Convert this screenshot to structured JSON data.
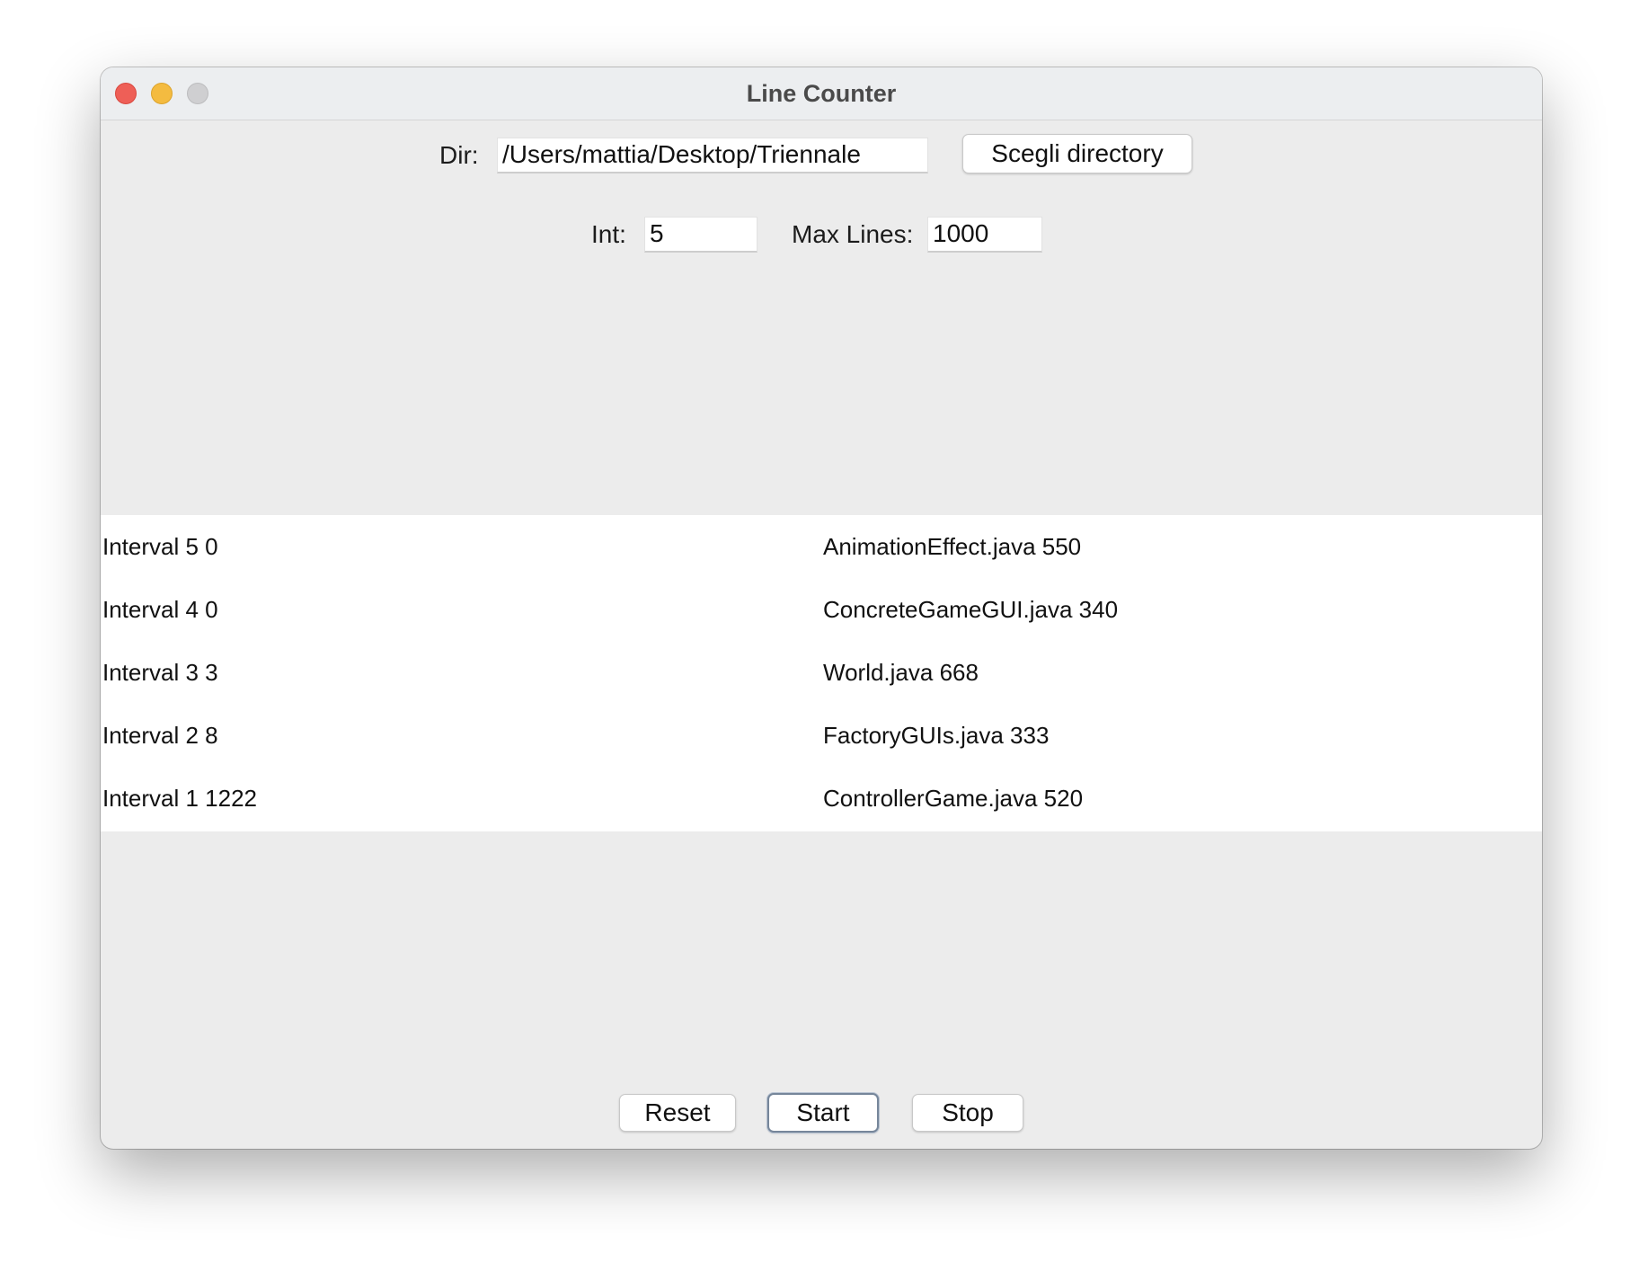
{
  "window": {
    "title": "Line Counter"
  },
  "controls": {
    "dir_label": "Dir:",
    "dir_value": "/Users/mattia/Desktop/Triennale",
    "choose_dir_label": "Scegli directory",
    "int_label": "Int:",
    "int_value": "5",
    "max_lines_label": "Max Lines:",
    "max_lines_value": "1000"
  },
  "results": {
    "intervals": [
      "Interval 5 0",
      "Interval 4 0",
      "Interval 3 3",
      "Interval 2 8",
      "Interval 1 1222"
    ],
    "files": [
      "AnimationEffect.java 550",
      "ConcreteGameGUI.java 340",
      "World.java 668",
      "FactoryGUIs.java 333",
      "ControllerGame.java 520"
    ]
  },
  "footer": {
    "reset_label": "Reset",
    "start_label": "Start",
    "stop_label": "Stop"
  }
}
